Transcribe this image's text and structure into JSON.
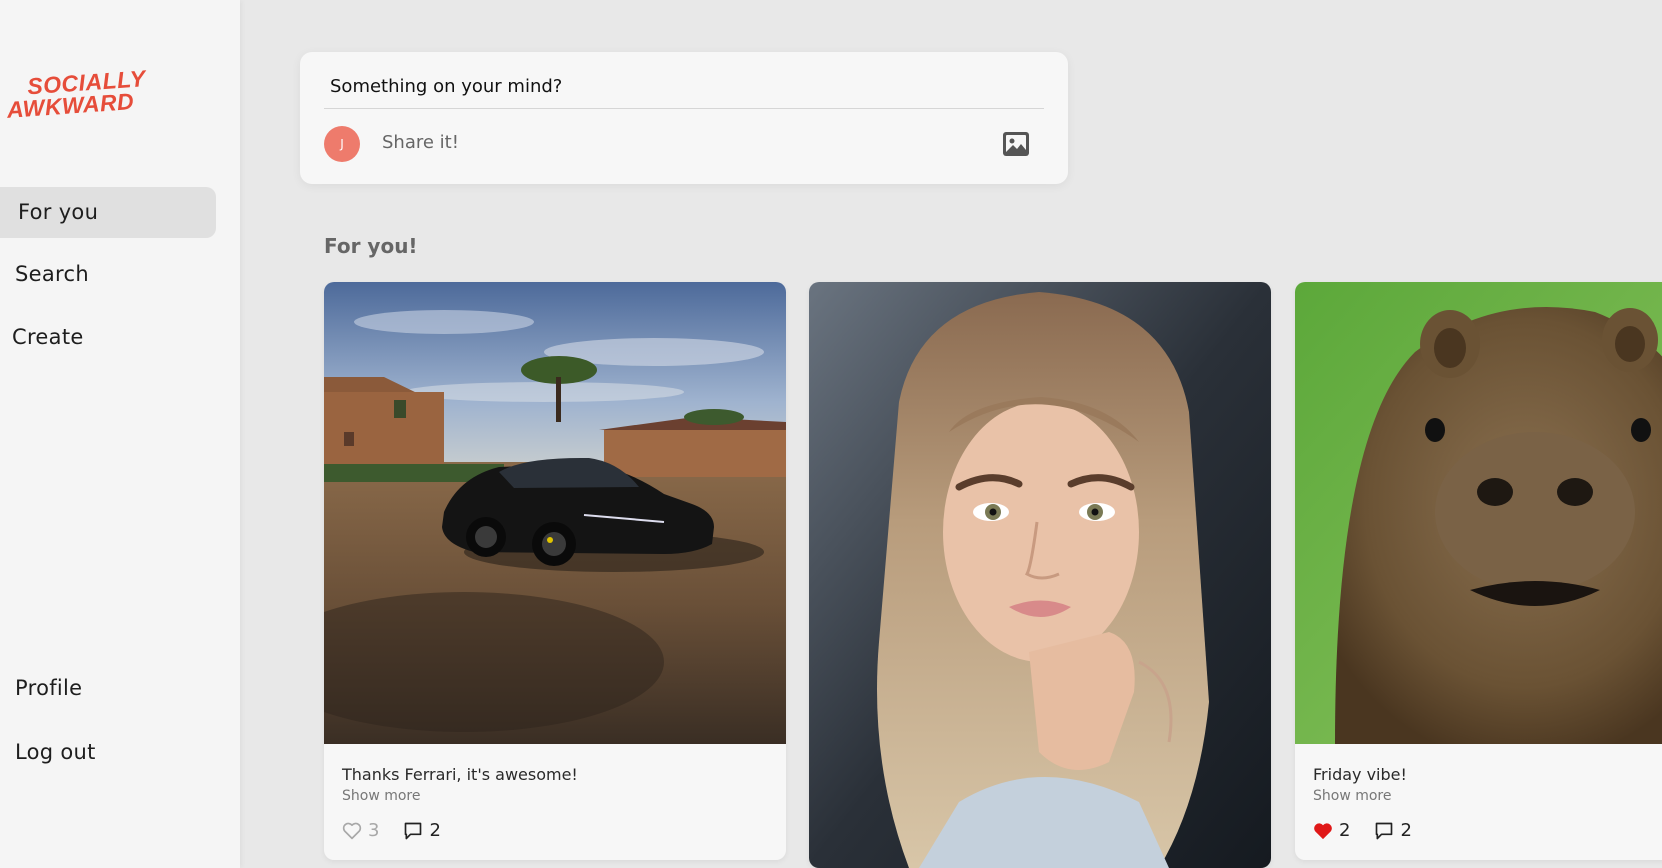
{
  "app": {
    "logo_line1": "SOCIALLY",
    "logo_line2": "AWKWARD",
    "brand_color": "#e64d3a"
  },
  "sidebar": {
    "items": [
      {
        "label": "For you",
        "active": true
      },
      {
        "label": "Search"
      },
      {
        "label": "Create"
      },
      {
        "label": "Profile"
      },
      {
        "label": "Log out"
      }
    ]
  },
  "composer": {
    "question": "Something on your mind?",
    "avatar_initial": "J",
    "placeholder": "Share it!",
    "icon": "image-icon",
    "avatar_color": "#ee7b6c"
  },
  "feed": {
    "title": "For you!",
    "posts": [
      {
        "image": "black sports car in front of farmhouse",
        "caption": "Thanks Ferrari, it's awesome!",
        "show_more": "Show more",
        "likes": "3",
        "liked": false,
        "comments": "2"
      },
      {
        "image": "selfie portrait of a young woman with long hair"
      },
      {
        "image": "close-up of a capybara on green grass",
        "caption": "Friday vibe!",
        "show_more": "Show more",
        "likes": "2",
        "liked": true,
        "comments": "2"
      }
    ]
  }
}
